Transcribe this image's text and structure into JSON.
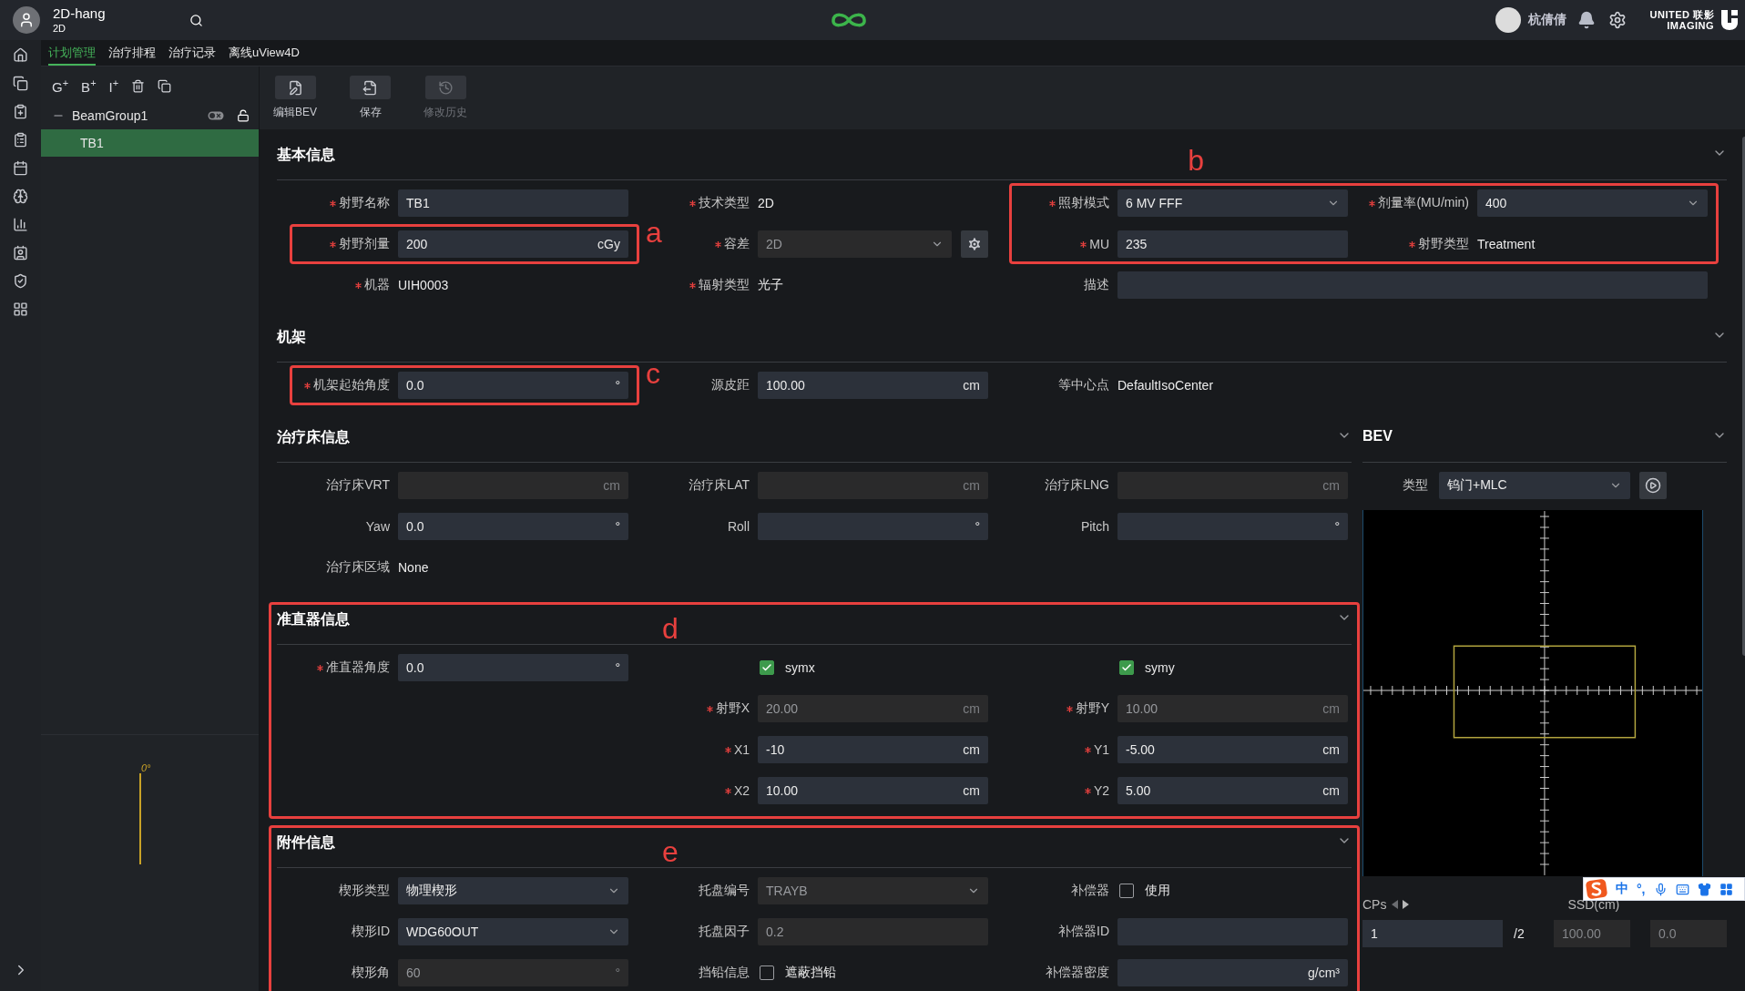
{
  "header": {
    "project": "2D-hang",
    "subtitle": "2D",
    "user": "杭倩倩",
    "brand": [
      "UNITED 联影",
      "IMAGING"
    ]
  },
  "tabs": [
    {
      "label": "计划管理",
      "selected": true
    },
    {
      "label": "治疗排程",
      "selected": false
    },
    {
      "label": "治疗记录",
      "selected": false
    },
    {
      "label": "离线uView4D",
      "selected": false
    }
  ],
  "plan_tools": [
    "G$^{+}$",
    "B$^{+}$",
    "I$^{+}$"
  ],
  "tree": [
    {
      "label": "BeamGroup1",
      "expanded": true,
      "selected": false,
      "children": [
        {
          "label": "TB1",
          "selected": true
        }
      ]
    }
  ],
  "gantry_view": {
    "angle": "0°"
  },
  "toolbar": [
    {
      "kind": "edit_bev",
      "label": "编辑BEV",
      "disabled": false
    },
    {
      "kind": "save",
      "label": "保存",
      "disabled": false
    },
    {
      "kind": "history",
      "label": "修改历史",
      "disabled": true
    }
  ],
  "form": {
    "upper": [
      {
        "title": "基本信息",
        "expanded": true,
        "columns": [
          [
            {
              "kind": "input",
              "label": "射野名称",
              "required": true,
              "value": "TB1",
              "disabled": false
            },
            {
              "kind": "input",
              "label": "射野剂量",
              "required": true,
              "value": "200",
              "unit": "cGy",
              "disabled": false,
              "annotation": "a"
            },
            {
              "kind": "text",
              "label": "机器",
              "required": true,
              "value": "UIH0003"
            }
          ],
          [
            {
              "kind": "text",
              "label": "技术类型",
              "required": true,
              "value": "2D"
            },
            {
              "kind": "select_gear",
              "label": "容差",
              "required": true,
              "value": "2D",
              "disabled": true
            },
            {
              "kind": "text",
              "label": "辐射类型",
              "required": true,
              "value": "光子"
            }
          ],
          [
            {
              "kind": "select",
              "label": "照射模式",
              "required": true,
              "value": "6 MV FFF",
              "disabled": false,
              "annotation": "b"
            },
            {
              "kind": "input",
              "label": "MU",
              "required": true,
              "value": "235",
              "disabled": false,
              "framed": true
            },
            {
              "kind": "wide_input",
              "label": "描述",
              "required": false,
              "disabled": false
            }
          ],
          [
            {
              "kind": "select",
              "label": "剂量率(MU/min)",
              "required": true,
              "value": "400",
              "disabled": false,
              "framed": true
            },
            {
              "kind": "text",
              "label": "射野类型",
              "required": true,
              "value": "Treatment",
              "framed": true
            }
          ]
        ]
      },
      {
        "title": "机架",
        "expanded": true,
        "columns": [
          [
            {
              "kind": "input",
              "label": "机架起始角度",
              "required": true,
              "value": "0.0",
              "unit": "°",
              "disabled": false,
              "annotation": "c"
            }
          ],
          [
            {
              "kind": "input",
              "label": "源皮距",
              "required": false,
              "value": "100.00",
              "unit": "cm",
              "disabled": false
            }
          ],
          [
            {
              "kind": "text",
              "label": "等中心点",
              "required": false,
              "value": "DefaultIsoCenter"
            }
          ]
        ]
      }
    ],
    "lower": [
      {
        "title": "治疗床信息",
        "expanded": true,
        "columns": [
          [
            {
              "kind": "input",
              "label": "治疗床VRT",
              "required": false,
              "unit": "cm",
              "disabled": true
            },
            {
              "kind": "input",
              "label": "Yaw",
              "required": false,
              "value": "0.0",
              "unit": "°",
              "disabled": false
            },
            {
              "kind": "text",
              "label": "治疗床区域",
              "required": false,
              "value": "None"
            }
          ],
          [
            {
              "kind": "input",
              "label": "治疗床LAT",
              "required": false,
              "unit": "cm",
              "disabled": true
            },
            {
              "kind": "input",
              "label": "Roll",
              "required": false,
              "unit": "°",
              "disabled": false
            }
          ],
          [
            {
              "kind": "input",
              "label": "治疗床LNG",
              "required": false,
              "unit": "cm",
              "disabled": true
            },
            {
              "kind": "input",
              "label": "Pitch",
              "required": false,
              "unit": "°",
              "disabled": false
            }
          ]
        ]
      },
      {
        "title": "准直器信息",
        "expanded": true,
        "annotation": "d",
        "columns": [
          [
            {
              "kind": "input",
              "label": "准直器角度",
              "required": true,
              "value": "0.0",
              "unit": "°",
              "disabled": false
            }
          ],
          [
            {
              "kind": "check",
              "option": "symx",
              "checked": true
            },
            {
              "kind": "input",
              "label": "射野X",
              "required": true,
              "value": "20.00",
              "unit": "cm",
              "disabled": true
            },
            {
              "kind": "input",
              "label": "X1",
              "required": true,
              "value": "-10",
              "unit": "cm",
              "disabled": false
            },
            {
              "kind": "input",
              "label": "X2",
              "required": true,
              "value": "10.00",
              "unit": "cm",
              "disabled": false
            }
          ],
          [
            {
              "kind": "check",
              "option": "symy",
              "checked": true
            },
            {
              "kind": "input",
              "label": "射野Y",
              "required": true,
              "value": "10.00",
              "unit": "cm",
              "disabled": true
            },
            {
              "kind": "input",
              "label": "Y1",
              "required": true,
              "value": "-5.00",
              "unit": "cm",
              "disabled": false
            },
            {
              "kind": "input",
              "label": "Y2",
              "required": true,
              "value": "5.00",
              "unit": "cm",
              "disabled": false
            }
          ]
        ]
      },
      {
        "title": "附件信息",
        "expanded": true,
        "annotation": "e",
        "columns": [
          [
            {
              "kind": "select",
              "label": "楔形类型",
              "required": false,
              "value": "物理楔形",
              "disabled": false
            },
            {
              "kind": "select",
              "label": "楔形ID",
              "required": false,
              "value": "WDG60OUT",
              "disabled": false
            },
            {
              "kind": "input",
              "label": "楔形角",
              "required": false,
              "value": "60",
              "unit": "°",
              "disabled": true
            }
          ],
          [
            {
              "kind": "select",
              "label": "托盘编号",
              "required": false,
              "value": "TRAYB",
              "disabled": true
            },
            {
              "kind": "input",
              "label": "托盘因子",
              "required": false,
              "value": "0.2",
              "disabled": true
            },
            {
              "kind": "check",
              "label": "挡铅信息",
              "option": "遮蔽挡铅",
              "checked": false
            }
          ],
          [
            {
              "kind": "check",
              "label": "补偿器",
              "option": "使用",
              "checked": false
            },
            {
              "kind": "input",
              "label": "补偿器ID",
              "required": false,
              "disabled": false
            },
            {
              "kind": "input",
              "label": "补偿器密度",
              "required": false,
              "unit": "g/cm³",
              "disabled": false
            }
          ]
        ]
      }
    ]
  },
  "bev": {
    "title": "BEV",
    "expanded": true,
    "type_label": "类型",
    "type_value": "钨门+MLC"
  },
  "control_points": {
    "label": "CPs",
    "current": "1",
    "total": "/2",
    "ssd_label": "SSD(cm)",
    "ssd": "100.00",
    "other": "0.0"
  },
  "ime": [
    "中",
    "°,"
  ]
}
